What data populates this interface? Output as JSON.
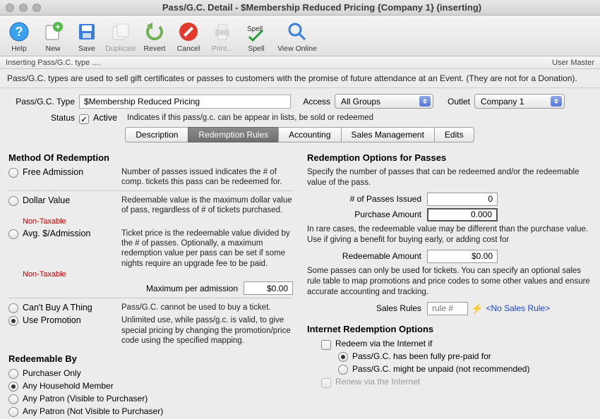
{
  "window": {
    "title": "Pass/G.C. Detail - $Membership Reduced Pricing {Company 1} (inserting)"
  },
  "toolbar": {
    "help": "Help",
    "new": "New",
    "save": "Save",
    "duplicate": "Duplicate",
    "revert": "Revert",
    "cancel": "Cancel",
    "print": "Print...",
    "spell": "Spell",
    "viewonline": "View Online"
  },
  "status": {
    "left": "Inserting Pass/G.C. type ....",
    "right": "User Master"
  },
  "info_text": "Pass/G.C. types are used to sell gift certificates or passes to customers with the promise of future attendance at an Event.  (They are not for a Donation).",
  "form": {
    "type_label": "Pass/G.C. Type",
    "type_value": "$Membership Reduced Pricing",
    "access_label": "Access",
    "access_value": "All Groups",
    "outlet_label": "Outlet",
    "outlet_value": "Company 1",
    "status_label": "Status",
    "active_label": "Active",
    "active_checked": true,
    "status_hint": "Indicates if this pass/g.c. can be appear in lists, be sold or redeemed"
  },
  "tabs": {
    "description": "Description",
    "redemption": "Redemption Rules",
    "accounting": "Accounting",
    "sales": "Sales Management",
    "edits": "Edits"
  },
  "left": {
    "method_title": "Method Of Redemption",
    "free_admission": "Free Admission",
    "free_admission_desc": "Number of passes issued indicates the # of comp. tickets this pass can be redeemed for.",
    "dollar_value": "Dollar Value",
    "nontax": "Non-Taxable",
    "dollar_value_desc": "Redeemable value is the maximum dollar value of pass, regardless of # of tickets purchased.",
    "avg_admission": "Avg. $/Admission",
    "avg_admission_desc": "Ticket price is the redeemable value divided by the # of passes.  Optionally, a maximum redemption value per pass can be set if some nights require an upgrade fee to be paid.",
    "max_label": "Maximum per admission",
    "max_value": "$0.00",
    "cant_buy": "Can't Buy A Thing",
    "cant_buy_desc": "Pass/G.C. cannot be used to buy a ticket.",
    "use_promo": "Use Promotion",
    "use_promo_desc": "Unlimited use, while pass/g.c. is valid, to give special pricing by changing the promotion/price code using the specified mapping.",
    "redeemable_title": "Redeemable By",
    "purchaser_only": "Purchaser Only",
    "any_household": "Any Household Member",
    "any_patron_vis": "Any Patron (Visible to Purchaser)",
    "any_patron_notvis": "Any Patron (Not Visible to Purchaser)"
  },
  "right": {
    "opts_title": "Redemption Options for Passes",
    "opts_desc": "Specify the number of passes that can be redeemed and/or the redeemable value of the pass.",
    "passes_label": "# of Passes Issued",
    "passes_value": "0",
    "purchase_label": "Purchase Amount",
    "purchase_value": "0.000",
    "rare_note": "In rare cases, the redeemable value may be different than the purchase value.  Use if giving a benefit for buying early, or adding cost for",
    "redeemable_label": "Redeemable Amount",
    "redeemable_value": "$0.00",
    "rules_note": "Some passes can only be used for tickets.  You can specify an optional sales rule table to map promotions and price codes to some other values and ensure accurate accounting and tracking.",
    "sales_rules_label": "Sales Rules",
    "sales_rules_placeholder": "rule #",
    "no_sales_rule": "<No Sales Rule>",
    "internet_title": "Internet Redemption Options",
    "redeem_internet": "Redeem via the Internet if",
    "prepaid": "Pass/G.C. has been fully pre-paid for",
    "unpaid": "Pass/G.C. might be unpaid (not recommended)",
    "renew": "Renew via the Internet"
  }
}
